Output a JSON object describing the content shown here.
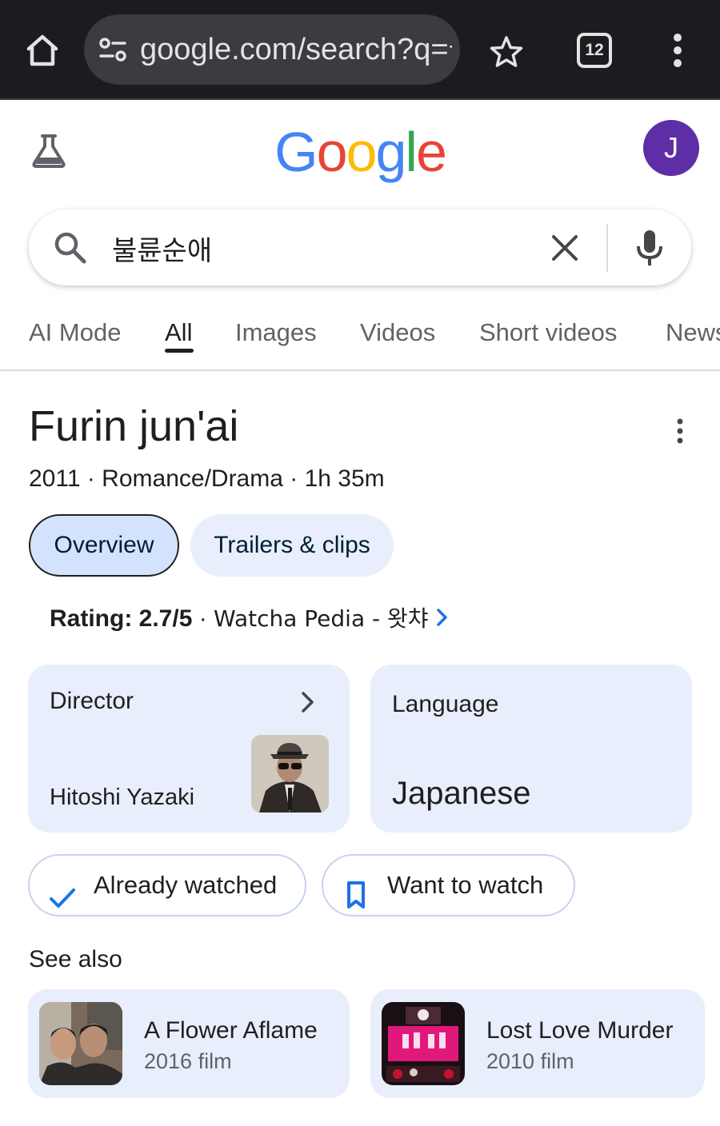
{
  "browser": {
    "url": "google.com/search?q=불",
    "tab_count": "12",
    "icons": [
      "home-icon",
      "site-settings-icon",
      "star-icon",
      "tabs-icon",
      "more-vert-icon"
    ]
  },
  "google": {
    "logo_letters": [
      {
        "char": "G",
        "color": "#4285F4"
      },
      {
        "char": "o",
        "color": "#EA4335"
      },
      {
        "char": "o",
        "color": "#FBBC05"
      },
      {
        "char": "g",
        "color": "#4285F4"
      },
      {
        "char": "l",
        "color": "#34A853"
      },
      {
        "char": "e",
        "color": "#EA4335"
      }
    ],
    "avatar_initial": "J",
    "avatar_color": "#5E2EA6"
  },
  "search": {
    "query": "불륜순애"
  },
  "tabs": [
    {
      "label": "AI Mode",
      "active": false
    },
    {
      "label": "All",
      "active": true
    },
    {
      "label": "Images",
      "active": false
    },
    {
      "label": "Videos",
      "active": false
    },
    {
      "label": "Short videos",
      "active": false
    },
    {
      "label": "News",
      "active": false
    }
  ],
  "movie": {
    "title": "Furin jun'ai",
    "subtitle": "2011 · Romance/Drama · 1h 35m",
    "chips": {
      "overview": "Overview",
      "trailers": "Trailers & clips"
    },
    "rating": {
      "label": "Rating: 2.7/5",
      "separator": " · ",
      "source": "Watcha Pedia - 왓챠"
    },
    "director": {
      "label": "Director",
      "name": "Hitoshi Yazaki"
    },
    "language": {
      "label": "Language",
      "value": "Japanese"
    },
    "actions": {
      "watched": "Already watched",
      "want": "Want to watch"
    }
  },
  "see_also": {
    "heading": "See also",
    "items": [
      {
        "title": "A Flower Aflame",
        "subtitle": "2016 film"
      },
      {
        "title": "Lost Love Murder",
        "subtitle": "2010 film"
      }
    ]
  },
  "colors": {
    "accent_blue": "#1a73e8",
    "chip_selected": "#D3E3FD",
    "card_bg": "#E8EEFB"
  }
}
